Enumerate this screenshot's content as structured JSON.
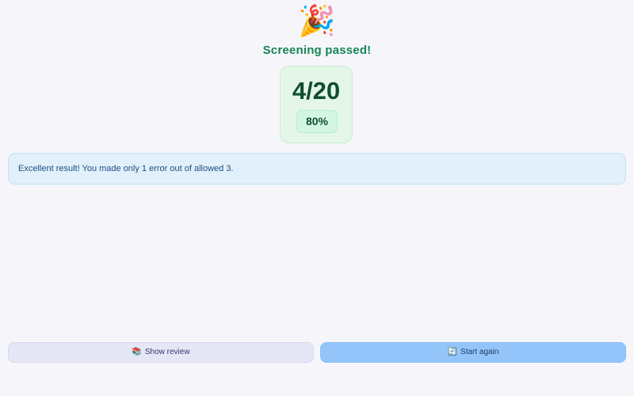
{
  "result": {
    "emoji": "🎉",
    "title": "Screening passed!",
    "score": "4/20",
    "percent": "80%"
  },
  "message": {
    "text": "Excellent result! You made only 1 error out of allowed 3."
  },
  "actions": {
    "review": {
      "icon": "📚",
      "icon_name": "books-icon",
      "label": "Show review"
    },
    "restart": {
      "icon": "🔄",
      "icon_name": "refresh-icon",
      "label": "Start again"
    }
  },
  "colors": {
    "title": "#178556",
    "score_card_bg": "#e3f6e7",
    "message_bg": "#e1f0fb",
    "review_button_bg": "#e5e6f6",
    "restart_button_bg": "#93c5fb"
  }
}
